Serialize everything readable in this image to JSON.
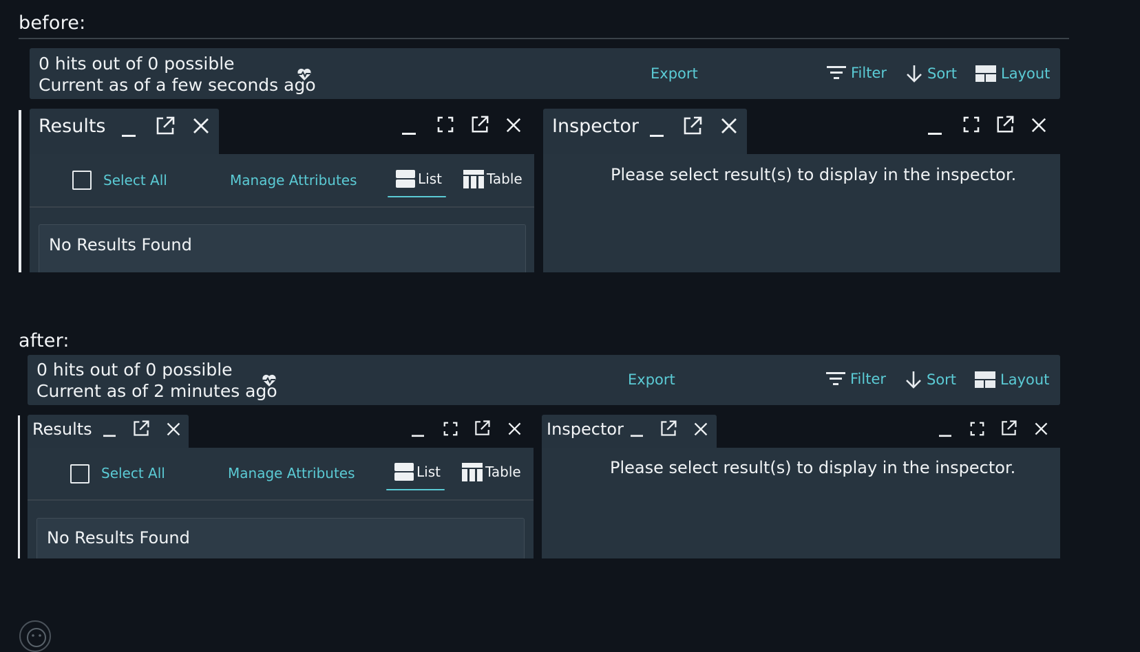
{
  "panels": [
    {
      "label": "before:",
      "status_line1": "0 hits out of 0 possible",
      "status_line2": "Current as of a few seconds ago",
      "export_label": "Export",
      "filter_label": "Filter",
      "sort_label": "Sort",
      "layout_label": "Layout",
      "results_tab_title": "Results",
      "inspector_tab_title": "Inspector",
      "select_all_label": "Select All",
      "manage_attributes_label": "Manage Attributes",
      "list_label": "List",
      "table_label": "Table",
      "no_results_text": "No Results Found",
      "inspector_message": "Please select result(s) to display in the inspector."
    },
    {
      "label": "after:",
      "status_line1": "0 hits out of 0 possible",
      "status_line2": "Current as of 2 minutes ago",
      "export_label": "Export",
      "filter_label": "Filter",
      "sort_label": "Sort",
      "layout_label": "Layout",
      "results_tab_title": "Results",
      "inspector_tab_title": "Inspector",
      "select_all_label": "Select All",
      "manage_attributes_label": "Manage Attributes",
      "list_label": "List",
      "table_label": "Table",
      "no_results_text": "No Results Found",
      "inspector_message": "Please select result(s) to display in the inspector."
    }
  ],
  "colors": {
    "background": "#0f141b",
    "panel": "#26333e",
    "accent": "#5bcbd5",
    "text": "#f2f4f6"
  },
  "icons": [
    "heartbeat-icon",
    "filter-icon",
    "sort-arrow-down-icon",
    "layout-icon",
    "minimize-icon",
    "maximize-icon",
    "popout-icon",
    "close-icon",
    "checkbox-icon",
    "list-icon",
    "table-icon",
    "avatar-icon"
  ]
}
